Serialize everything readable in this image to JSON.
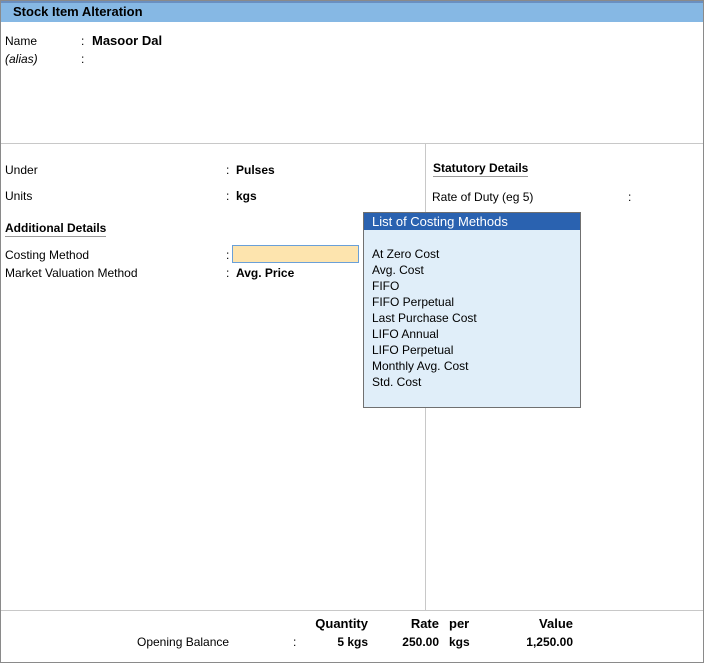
{
  "title": "Stock Item Alteration",
  "name": {
    "label": "Name",
    "value": "Masoor Dal"
  },
  "alias": {
    "label": "(alias)",
    "value": ""
  },
  "under": {
    "label": "Under",
    "value": "Pulses"
  },
  "units": {
    "label": "Units",
    "value": "kgs"
  },
  "additional": {
    "heading": "Additional Details",
    "costing_label": "Costing Method",
    "costing_value": "",
    "market_label": "Market Valuation Method",
    "market_value": "Avg. Price"
  },
  "statutory": {
    "heading": "Statutory Details",
    "rate_label": "Rate of Duty (eg 5)",
    "rate_value": ""
  },
  "popup": {
    "title": "List of Costing Methods",
    "items": [
      "At Zero Cost",
      "Avg. Cost",
      "FIFO",
      "FIFO Perpetual",
      "Last Purchase Cost",
      "LIFO Annual",
      "LIFO Perpetual",
      "Monthly Avg. Cost",
      "Std. Cost"
    ]
  },
  "opening": {
    "label": "Opening Balance",
    "headers": {
      "quantity": "Quantity",
      "rate": "Rate",
      "per": "per",
      "value": "Value"
    },
    "quantity": "5 kgs",
    "rate": "250.00",
    "per": "kgs",
    "value": "1,250.00"
  }
}
